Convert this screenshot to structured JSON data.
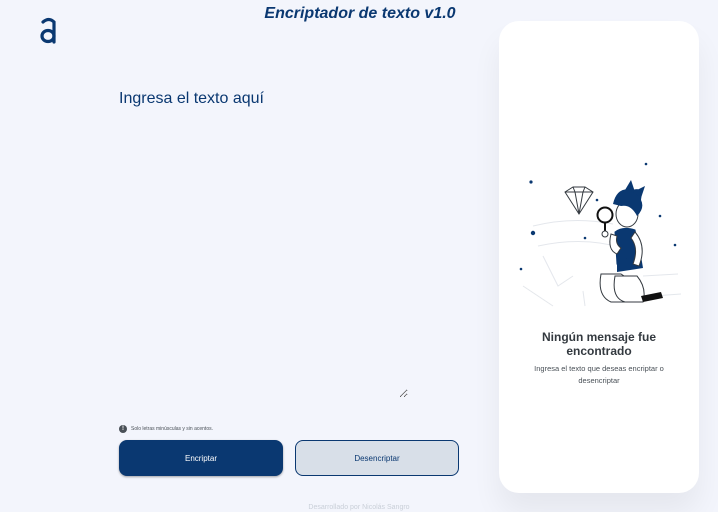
{
  "header": {
    "title": "Encriptador de texto v1.0",
    "logo_icon": "alura-logo-icon"
  },
  "input": {
    "placeholder": "Ingresa el texto aquí",
    "value": ""
  },
  "hint": {
    "icon": "info-icon",
    "text": "Solo letras minúsculas y sin acentos."
  },
  "buttons": {
    "encrypt_label": "Encriptar",
    "decrypt_label": "Desencriptar"
  },
  "output_panel": {
    "illustration": "person-with-magnifier-illustration",
    "title": "Ningún mensaje fue encontrado",
    "subtitle": "Ingresa el texto que deseas encriptar o desencriptar"
  },
  "footer": {
    "text": "Desarrollado por Nicolás Sangro"
  },
  "colors": {
    "background": "#f3f5fc",
    "primary": "#0a3871",
    "secondary_button": "#d8dfe8",
    "panel": "#ffffff"
  }
}
